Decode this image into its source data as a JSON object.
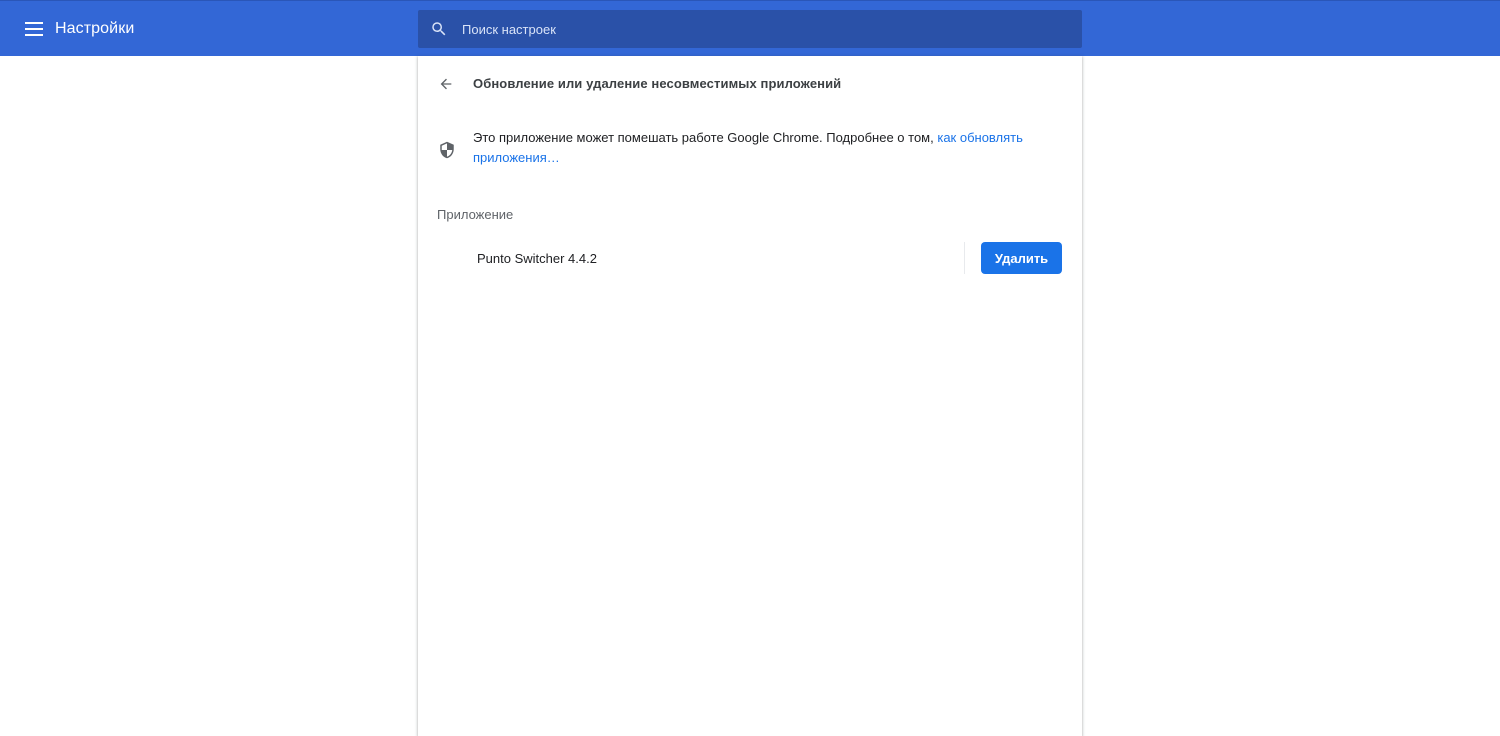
{
  "header": {
    "title": "Настройки",
    "menu_icon": "hamburger-menu-icon"
  },
  "search": {
    "placeholder": "Поиск настроек",
    "value": "",
    "icon": "search-icon"
  },
  "page": {
    "title": "Обновление или удаление несовместимых приложений",
    "back_icon": "arrow-back-icon",
    "info": {
      "icon": "shield-icon",
      "text": "Это приложение может помешать работе Google Chrome. Подробнее о том, ",
      "link_text": "как обновлять приложения…"
    },
    "section_label": "Приложение",
    "apps": [
      {
        "name": "Punto Switcher 4.4.2",
        "action_label": "Удалить"
      }
    ]
  },
  "colors": {
    "header_bg": "#3367d6",
    "search_bg": "#2a51a8",
    "link": "#1a73e8",
    "button_bg": "#1a73e8"
  }
}
